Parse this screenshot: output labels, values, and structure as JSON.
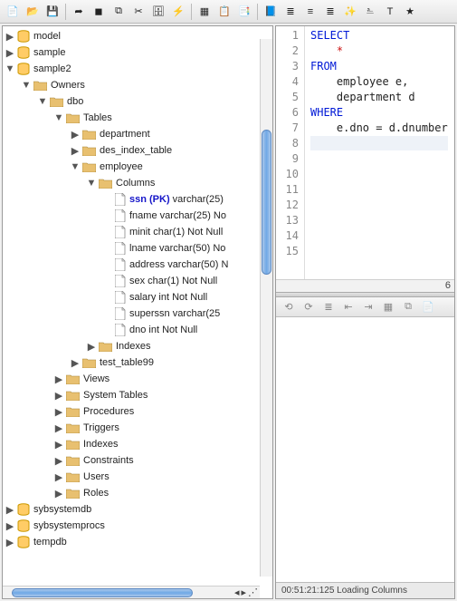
{
  "toolbar": [
    {
      "name": "new-icon",
      "title": "New"
    },
    {
      "name": "open-icon",
      "title": "Open"
    },
    {
      "name": "save-icon",
      "title": "Save"
    },
    {
      "sep": true
    },
    {
      "name": "run-icon",
      "title": "Run"
    },
    {
      "name": "stop-icon",
      "title": "Stop"
    },
    {
      "name": "copy-icon",
      "title": "Copy"
    },
    {
      "name": "cut-icon",
      "title": "Cut"
    },
    {
      "name": "db-icon",
      "title": "DB"
    },
    {
      "name": "lightning-icon",
      "title": "Exec"
    },
    {
      "sep": true
    },
    {
      "name": "sheet-icon",
      "title": "Sheet"
    },
    {
      "name": "clip-icon",
      "title": "Clip"
    },
    {
      "name": "doc-icon",
      "title": "Doc"
    },
    {
      "sep": true
    },
    {
      "name": "book-icon",
      "title": "Bookmarks"
    },
    {
      "name": "lines-icon",
      "title": "Lines"
    },
    {
      "name": "align-left-icon",
      "title": "Align"
    },
    {
      "name": "align-right-icon",
      "title": "Align2"
    },
    {
      "name": "wand-icon",
      "title": "Wand"
    },
    {
      "name": "format-icon",
      "title": "Format"
    },
    {
      "name": "text-icon",
      "title": "Text"
    },
    {
      "name": "star-icon",
      "title": "Star"
    }
  ],
  "tree": {
    "model": "model",
    "sample": "sample",
    "sample2": "sample2",
    "owners": "Owners",
    "dbo": "dbo",
    "tables": "Tables",
    "department": "department",
    "des_index_table": "des_index_table",
    "employee": "employee",
    "columns": "Columns",
    "cols": [
      {
        "pk": true,
        "name": "ssn",
        "pkLabel": "ssn (PK)",
        "rest": " varchar(25)"
      },
      {
        "name": "fname",
        "rest": " varchar(25) No"
      },
      {
        "name": "minit",
        "rest": " char(1) Not Null"
      },
      {
        "name": "lname",
        "rest": " varchar(50) No"
      },
      {
        "name": "address",
        "rest": " varchar(50) N"
      },
      {
        "name": "sex",
        "rest": " char(1) Not Null"
      },
      {
        "name": "salary",
        "rest": " int Not Null"
      },
      {
        "name": "superssn",
        "rest": " varchar(25"
      },
      {
        "name": "dno",
        "rest": " int Not Null"
      }
    ],
    "indexes": "Indexes",
    "test_table99": "test_table99",
    "views": "Views",
    "system_tables": "System Tables",
    "procedures": "Procedures",
    "triggers": "Triggers",
    "indexes2": "Indexes",
    "constraints": "Constraints",
    "users": "Users",
    "roles": "Roles",
    "sybsystemdb": "sybsystemdb",
    "sybsystemprocs": "sybsystemprocs",
    "tempdb": "tempdb"
  },
  "sql": {
    "l1": "SELECT",
    "l2": "    *",
    "l3": "FROM",
    "l4": "    employee e,",
    "l5": "    department d",
    "l6": "WHERE",
    "l7": "    e.dno = d.dnumber"
  },
  "editor": {
    "lines": 15,
    "hscroll_label": "6"
  },
  "status": "00:51:21:125 Loading Columns"
}
